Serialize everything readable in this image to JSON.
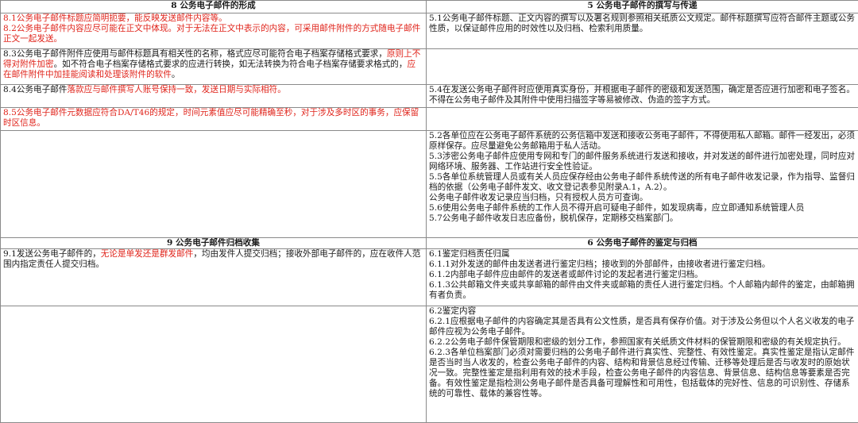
{
  "headers": {
    "left_top": "8 公务电子邮件的形成",
    "right_top": "5 公务电子邮件的撰写与传递",
    "left_mid": "9 公务电子邮件归档收集",
    "right_mid": "6 公务电子邮件的鉴定与归档"
  },
  "row1": {
    "left": {
      "a": "8.1公务电子邮件标题应简明扼要，能反映发送邮件内容等。",
      "b": "8.2公务电子邮件内容应尽可能在正文中体现。对于无法在正文中表示的内容，可采用邮件附件的方式随电子邮件正文一起发送。"
    },
    "right": "5.1公务电子邮件标题、正文内容的撰写以及署名规则参照相关纸质公文规定。邮件标题撰写应符合邮件主题或公务性质，以保证邮件应用的时效性以及归档、检索利用质量。"
  },
  "row2": {
    "left": {
      "black1": "8.3公务电子邮件附件应使用与邮件标题具有相关性的名称，格式应尽可能符合电子档案存储格式要求，",
      "red1": "原则上不得对附件加密",
      "black2": "。如不符合电子档案存储格式要求的应进行转换，如无法转换为符合电子档案存储要求格式的，",
      "red2": "应在邮件附件中加挂能阅读和处理该附件的软件",
      "black3": "。"
    },
    "right": ""
  },
  "row3": {
    "left": {
      "black1": "8.4公务电子邮件",
      "red1": "落款应与邮件撰写人账号保持一致，发送日期与实际相符。"
    },
    "right": "5.4在发送公务电子邮件时应使用真实身份，并根据电子邮件的密级和发送范围，确定是否应进行加密和电子签名。不得在公务电子邮件及其附件中使用扫描签字等易被修改、伪造的签字方式。"
  },
  "row4": {
    "left": "8.5公务电子邮件元数据应符合DA/T46的规定，时间元素值应尽可能精确至秒，对于涉及多时区的事务，应保留时区信息。",
    "right": ""
  },
  "row5": {
    "left": "",
    "right": [
      "5.2各单位应在公务电子邮件系统的公务信箱中发送和接收公务电子邮件，不得使用私人邮箱。邮件一经发出，必须原样保存。应尽量避免公务邮箱用于私人活动。",
      "5.3涉密公务电子邮件应使用专网和专门的邮件服务系统进行发送和接收，并对发送的邮件进行加密处理，同时应对网络环境、服务器、工作站进行安全性验证。",
      "5.5各单位系统管理人员或有关人员应保存经由公务电子邮件系统传送的所有电子邮件收发记录，作为指导、监督归档的依据（公务电子邮件发文、收文登记表参见附录A.1，A.2）。",
      "公务电子邮件收发记录应当归档，只有授权人员方可查询。",
      "5.6使用公务电子邮件系统的工作人员不得开启可疑电子邮件，如发现病毒，应立即通知系统管理人员",
      "5.7公务电子邮件收发日志应备份，脱机保存，定期移交档案部门。"
    ]
  },
  "row6": {
    "left": {
      "black1": "9.1发送公务电子邮件的，",
      "red1": "无论是单发还是群发邮件",
      "black2": "，均由发件人提交归档；接收外部电子邮件的，应在收件人范围内指定责任人提交归档。"
    },
    "right": [
      "6.1鉴定归档责任归属",
      "6.1.1对外发送的邮件由发送者进行鉴定归档；接收到的外部邮件，由接收者进行鉴定归档。",
      "6.1.2内部电子邮件应由邮件的发送者或邮件讨论的发起者进行鉴定归档。",
      "6.1.3公共邮箱文件夹或共享邮箱的邮件由文件夹或邮箱的责任人进行鉴定归档。个人邮箱内邮件的鉴定，由邮箱拥有者负责。"
    ]
  },
  "row7": {
    "left": "",
    "right": [
      "6.2鉴定内容",
      "6.2.1应根据电子邮件的内容确定其是否具有公文性质，是否具有保存价值。对于涉及公务但以个人名义收发的电子邮件应视为公务电子邮件。",
      "6.2.2公务电子邮件保管期限和密级的划分工作，参照国家有关纸质文件材料的保管期限和密级的有关规定执行。",
      "6.2.3各单位档案部门必须对需要归档的公务电子邮件进行真实性、完整性、有效性鉴定。真实性鉴定是指认定邮件是否当时当人收发的，检查公务电子邮件的内容、结构和背景信息经过传输、迁移等处理后是否与收发时的原始状况一致。完整性鉴定是指利用有效的技术手段，检查公务电子邮件的内容信息、背景信息、结构信息等要素是否完备。有效性鉴定是指检测公务电子邮件是否具备可理解性和可用性，包括载体的完好性、信息的可识别性、存储系统的可靠性、载体的兼容性等。"
    ]
  },
  "colors": {
    "red_text": "#e0241b",
    "border": "#8a8a8a",
    "text": "#1a1a1a"
  }
}
